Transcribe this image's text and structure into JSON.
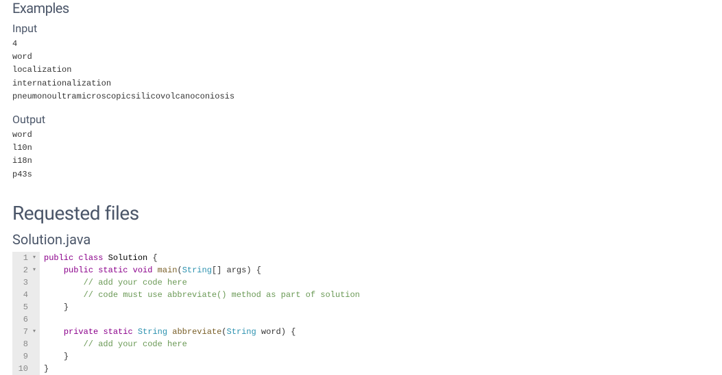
{
  "examples": {
    "heading": "Examples",
    "input_label": "Input",
    "input_text": "4\nword\nlocalization\ninternationalization\npneumonoultramicroscopicsilicovolcanoconiosis",
    "output_label": "Output",
    "output_text": "word\nl10n\ni18n\np43s"
  },
  "requested_files": {
    "heading": "Requested files",
    "filename": "Solution.java",
    "code_lines": [
      {
        "num": "1",
        "fold": true,
        "tokens": [
          {
            "cls": "tok-keyword",
            "t": "public"
          },
          {
            "cls": "tok-plain",
            "t": " "
          },
          {
            "cls": "tok-keyword",
            "t": "class"
          },
          {
            "cls": "tok-plain",
            "t": " "
          },
          {
            "cls": "tok-class",
            "t": "Solution"
          },
          {
            "cls": "tok-plain",
            "t": " {"
          }
        ]
      },
      {
        "num": "2",
        "fold": true,
        "indent": "    ",
        "tokens": [
          {
            "cls": "tok-keyword",
            "t": "public"
          },
          {
            "cls": "tok-plain",
            "t": " "
          },
          {
            "cls": "tok-keyword",
            "t": "static"
          },
          {
            "cls": "tok-plain",
            "t": " "
          },
          {
            "cls": "tok-keyword",
            "t": "void"
          },
          {
            "cls": "tok-plain",
            "t": " "
          },
          {
            "cls": "tok-method",
            "t": "main"
          },
          {
            "cls": "tok-plain",
            "t": "("
          },
          {
            "cls": "tok-type",
            "t": "String"
          },
          {
            "cls": "tok-plain",
            "t": "[] args) {"
          }
        ]
      },
      {
        "num": "3",
        "fold": false,
        "indent": "        ",
        "tokens": [
          {
            "cls": "tok-comment",
            "t": "// add your code here"
          }
        ]
      },
      {
        "num": "4",
        "fold": false,
        "indent": "        ",
        "tokens": [
          {
            "cls": "tok-comment",
            "t": "// code must use abbreviate() method as part of solution"
          }
        ]
      },
      {
        "num": "5",
        "fold": false,
        "indent": "    ",
        "tokens": [
          {
            "cls": "tok-plain",
            "t": "}"
          }
        ]
      },
      {
        "num": "6",
        "fold": false,
        "indent": "",
        "tokens": [
          {
            "cls": "tok-plain",
            "t": ""
          }
        ]
      },
      {
        "num": "7",
        "fold": true,
        "indent": "    ",
        "tokens": [
          {
            "cls": "tok-keyword",
            "t": "private"
          },
          {
            "cls": "tok-plain",
            "t": " "
          },
          {
            "cls": "tok-keyword",
            "t": "static"
          },
          {
            "cls": "tok-plain",
            "t": " "
          },
          {
            "cls": "tok-type",
            "t": "String"
          },
          {
            "cls": "tok-plain",
            "t": " "
          },
          {
            "cls": "tok-method",
            "t": "abbreviate"
          },
          {
            "cls": "tok-plain",
            "t": "("
          },
          {
            "cls": "tok-type",
            "t": "String"
          },
          {
            "cls": "tok-plain",
            "t": " word) {"
          }
        ]
      },
      {
        "num": "8",
        "fold": false,
        "indent": "        ",
        "tokens": [
          {
            "cls": "tok-comment",
            "t": "// add your code here"
          }
        ]
      },
      {
        "num": "9",
        "fold": false,
        "indent": "    ",
        "tokens": [
          {
            "cls": "tok-plain",
            "t": "}"
          }
        ]
      },
      {
        "num": "10",
        "fold": false,
        "indent": "",
        "tokens": [
          {
            "cls": "tok-plain",
            "t": "}"
          }
        ]
      }
    ]
  }
}
